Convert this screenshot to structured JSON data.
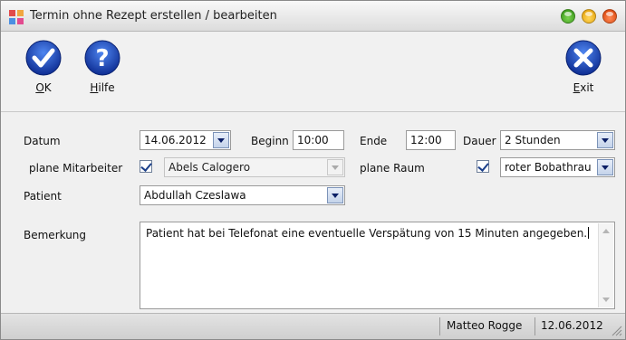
{
  "window": {
    "title": "Termin ohne Rezept erstellen / bearbeiten"
  },
  "toolbar": {
    "ok_underlined": "O",
    "ok_rest": "K",
    "help_underlined": "H",
    "help_rest": "ilfe",
    "exit_underlined": "E",
    "exit_rest": "xit"
  },
  "form": {
    "datum_label": "Datum",
    "datum_value": "14.06.2012",
    "beginn_label": "Beginn",
    "beginn_value": "10:00",
    "ende_label": "Ende",
    "ende_value": "12:00",
    "dauer_label": "Dauer",
    "dauer_value": "2 Stunden",
    "plane_mitarbeiter_label": "plane Mitarbeiter",
    "mitarbeiter_value": "Abels Calogero",
    "plane_raum_label": "plane Raum",
    "raum_value": "roter Bobathrau",
    "patient_label": "Patient",
    "patient_value": "Abdullah Czeslawa",
    "bemerkung_label": "Bemerkung",
    "bemerkung_value": "Patient hat bei Telefonat eine eventuelle Verspätung von 15 Minuten angegeben."
  },
  "status": {
    "user": "Matteo Rogge",
    "date": "12.06.2012"
  },
  "colors": {
    "button_blue": "#2358d8",
    "button_blue_dark": "#0f2f95"
  }
}
